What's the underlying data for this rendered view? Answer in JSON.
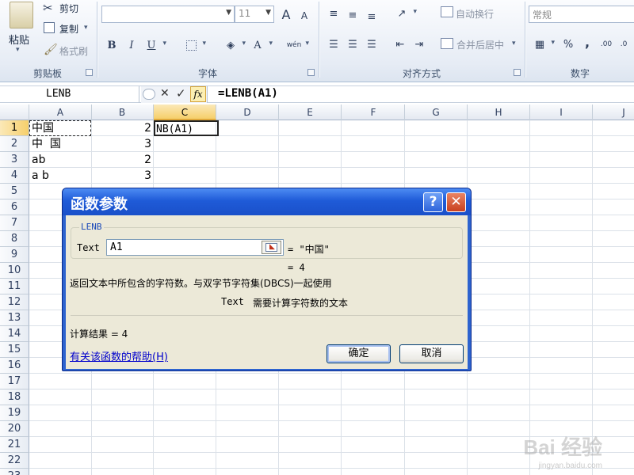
{
  "ribbon": {
    "clipboard": {
      "paste": "粘贴",
      "cut": "剪切",
      "copy": "复制",
      "format_painter": "格式刷",
      "group_title": "剪贴板"
    },
    "font": {
      "font_name": "",
      "font_size": "11",
      "bold": "B",
      "italic": "I",
      "underline": "U",
      "font_color": "A",
      "phonetic": "wén",
      "grow": "A",
      "shrink": "A",
      "group_title": "字体"
    },
    "alignment": {
      "wrap_text": "自动换行",
      "merge_center": "合并后居中",
      "group_title": "对齐方式"
    },
    "number": {
      "format": "常规",
      "percent": "%",
      "comma": ",",
      "group_title": "数字"
    }
  },
  "formula_bar": {
    "name_box": "LENB",
    "cancel": "✕",
    "enter": "✓",
    "fx": "fx",
    "formula": "=LENB(A1)"
  },
  "columns": [
    "A",
    "B",
    "C",
    "D",
    "E",
    "F",
    "G",
    "H",
    "I",
    "J"
  ],
  "selected_column": "C",
  "rows": [
    "1",
    "2",
    "3",
    "4",
    "5",
    "6",
    "7",
    "8",
    "9",
    "10",
    "11",
    "12",
    "13",
    "14",
    "15",
    "16",
    "17",
    "18",
    "19",
    "20",
    "21",
    "22",
    "23"
  ],
  "cells": {
    "a1": "中国",
    "b1": "2",
    "c1": "NB(A1)",
    "a2": "中  国",
    "b2": "3",
    "a3": "ab",
    "b3": "2",
    "a4": "a b",
    "b4": "3"
  },
  "dialog": {
    "title": "函数参数",
    "help_button": "?",
    "close_button": "✕",
    "function_name": "LENB",
    "arg_label": "Text",
    "arg_value": "A1",
    "arg_result": "= \"中国\"",
    "result_preview": "= 4",
    "description": "返回文本中所包含的字符数。与双字节字符集(DBCS)一起使用",
    "arg_help_name": "Text",
    "arg_help_text": "需要计算字符数的文本",
    "calc_result": "计算结果 = 4",
    "help_link": "有关该函数的帮助(H)",
    "ok": "确定",
    "cancel": "取消"
  },
  "watermark": {
    "text": "Bai 经验",
    "url": "jingyan.baidu.com"
  }
}
